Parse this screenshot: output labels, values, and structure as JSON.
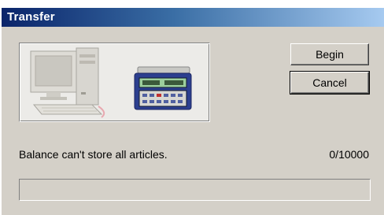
{
  "window": {
    "title": "Transfer"
  },
  "buttons": {
    "begin_label": "Begin",
    "cancel_label": "Cancel"
  },
  "status": {
    "message": "Balance can't store all articles.",
    "count": "0/10000"
  },
  "progress": {
    "fraction": 0
  },
  "illustration": {
    "icons": [
      "computer-icon",
      "balance-scale-icon"
    ]
  }
}
